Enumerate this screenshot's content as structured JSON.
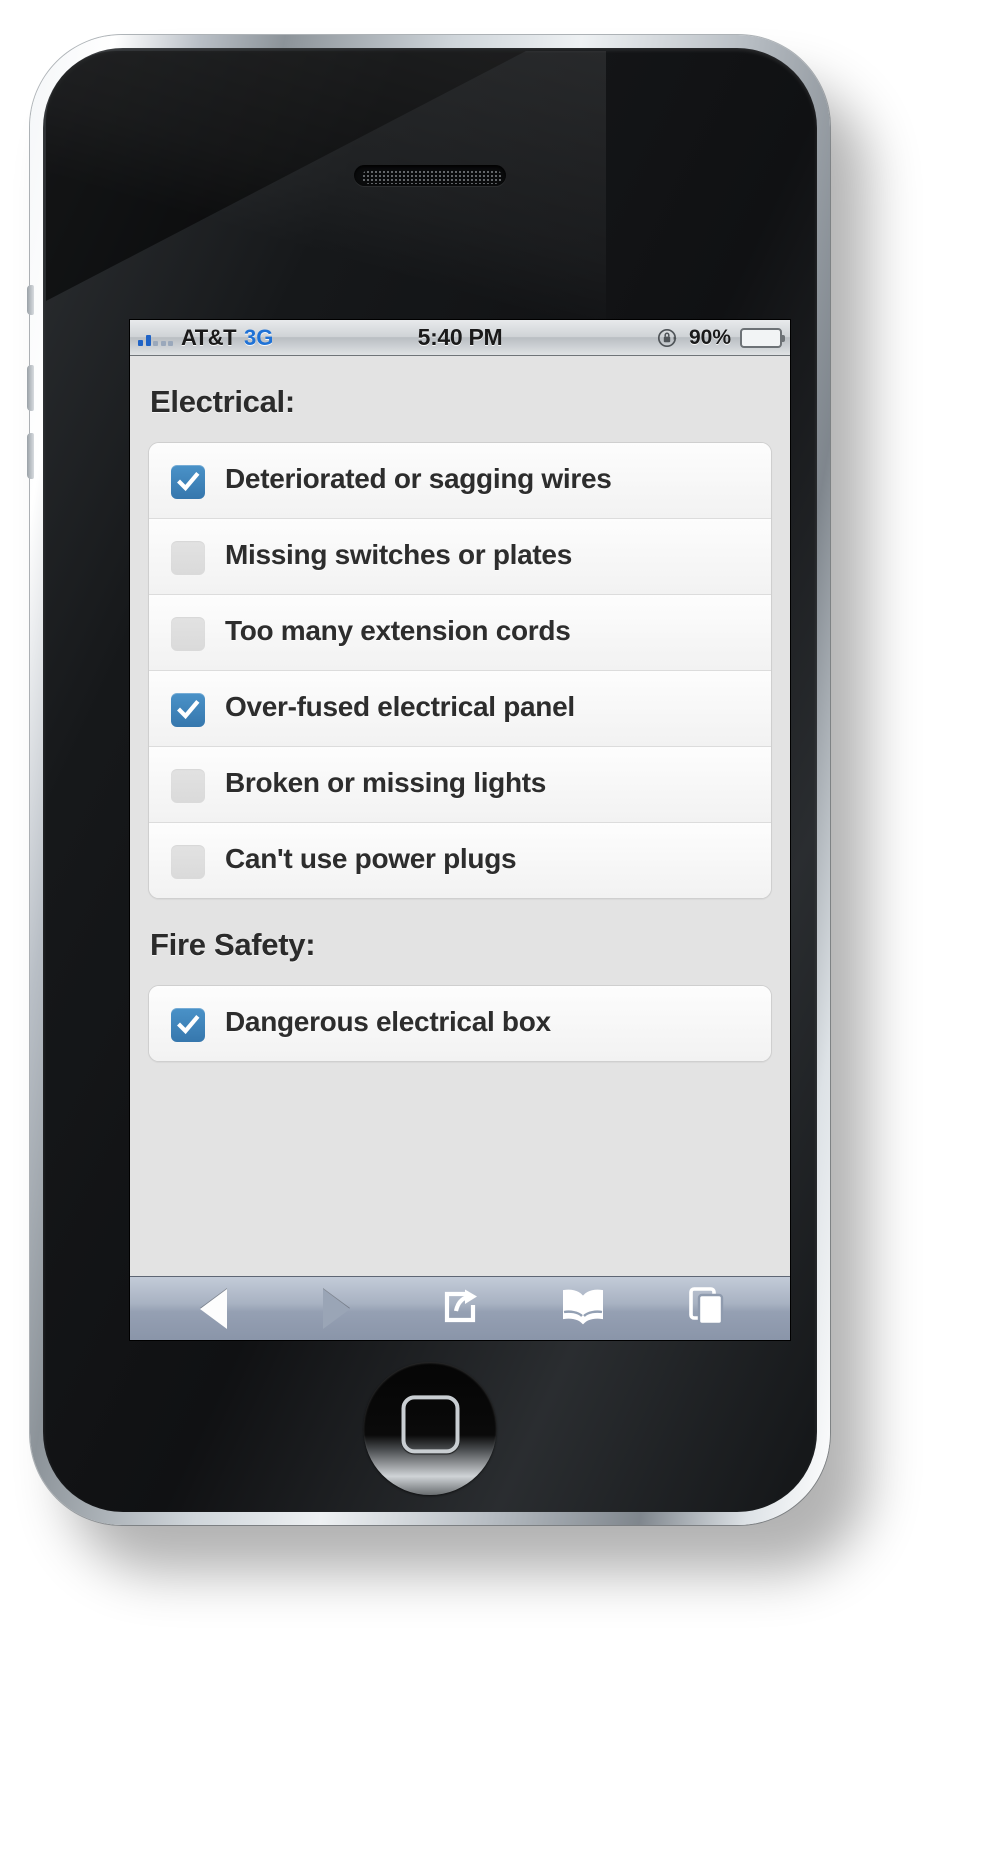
{
  "status_bar": {
    "carrier": "AT&T",
    "network": "3G",
    "time": "5:40 PM",
    "battery_percent": "90%",
    "signal_bars_filled": 2,
    "signal_bars_total": 5,
    "rotation_lock_icon": "rotation-lock-icon",
    "battery_icon": "battery-icon",
    "battery_color": "#4fcb22",
    "network_color": "#1f72d6"
  },
  "page": {
    "sections": [
      {
        "title": "Electrical:",
        "items": [
          {
            "label": "Deteriorated or sagging wires",
            "checked": true
          },
          {
            "label": "Missing switches or plates",
            "checked": false
          },
          {
            "label": "Too many extension cords",
            "checked": false
          },
          {
            "label": "Over-fused electrical panel",
            "checked": true
          },
          {
            "label": "Broken or missing lights",
            "checked": false
          },
          {
            "label": "Can't use power plugs",
            "checked": false
          }
        ]
      },
      {
        "title": "Fire Safety:",
        "items": [
          {
            "label": "Dangerous electrical box",
            "checked": true
          }
        ]
      }
    ],
    "checkbox_checked_color": "#3d85bd",
    "checkbox_unchecked_color": "#dedede",
    "background_color": "#e3e3e3"
  },
  "toolbar": {
    "buttons": [
      {
        "name": "back-button",
        "icon": "back-arrow-icon",
        "enabled": true
      },
      {
        "name": "forward-button",
        "icon": "forward-arrow-icon",
        "enabled": false
      },
      {
        "name": "share-button",
        "icon": "share-icon",
        "enabled": true
      },
      {
        "name": "bookmarks-button",
        "icon": "book-icon",
        "enabled": true
      },
      {
        "name": "tabs-button",
        "icon": "pages-icon",
        "enabled": true
      }
    ]
  },
  "device": {
    "speaker": "speaker-grille",
    "home_button": "home-button"
  }
}
